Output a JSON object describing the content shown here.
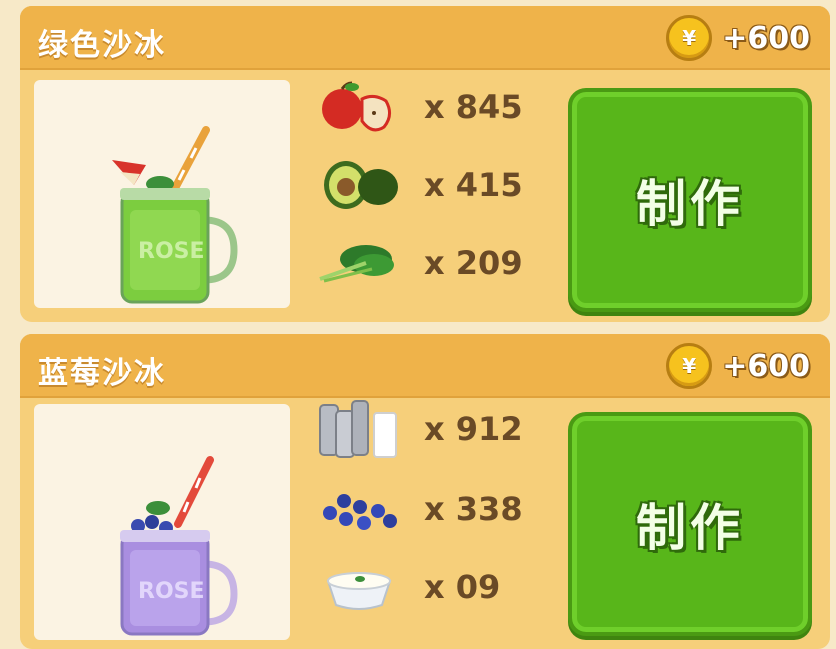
{
  "recipes": [
    {
      "title": "绿色沙冰",
      "coin_symbol": "¥",
      "reward": "+600",
      "drink_icon": "green-smoothie-jar",
      "ingredients": [
        {
          "icon": "apple-icon",
          "qty": "x 845"
        },
        {
          "icon": "avocado-icon",
          "qty": "x 415"
        },
        {
          "icon": "spinach-icon",
          "qty": "x 209"
        }
      ],
      "button_label": "制作"
    },
    {
      "title": "蓝莓沙冰",
      "coin_symbol": "¥",
      "reward": "+600",
      "drink_icon": "blueberry-smoothie-jar",
      "ingredients": [
        {
          "icon": "milk-icon",
          "qty": "x 912"
        },
        {
          "icon": "blueberry-icon",
          "qty": "x 338"
        },
        {
          "icon": "yogurt-icon",
          "qty": "x 09"
        }
      ],
      "button_label": "制作"
    }
  ],
  "colors": {
    "card": "#f6cf7a",
    "header": "#efb34a",
    "button": "#58b61a",
    "qty_text": "#6a4a26"
  }
}
